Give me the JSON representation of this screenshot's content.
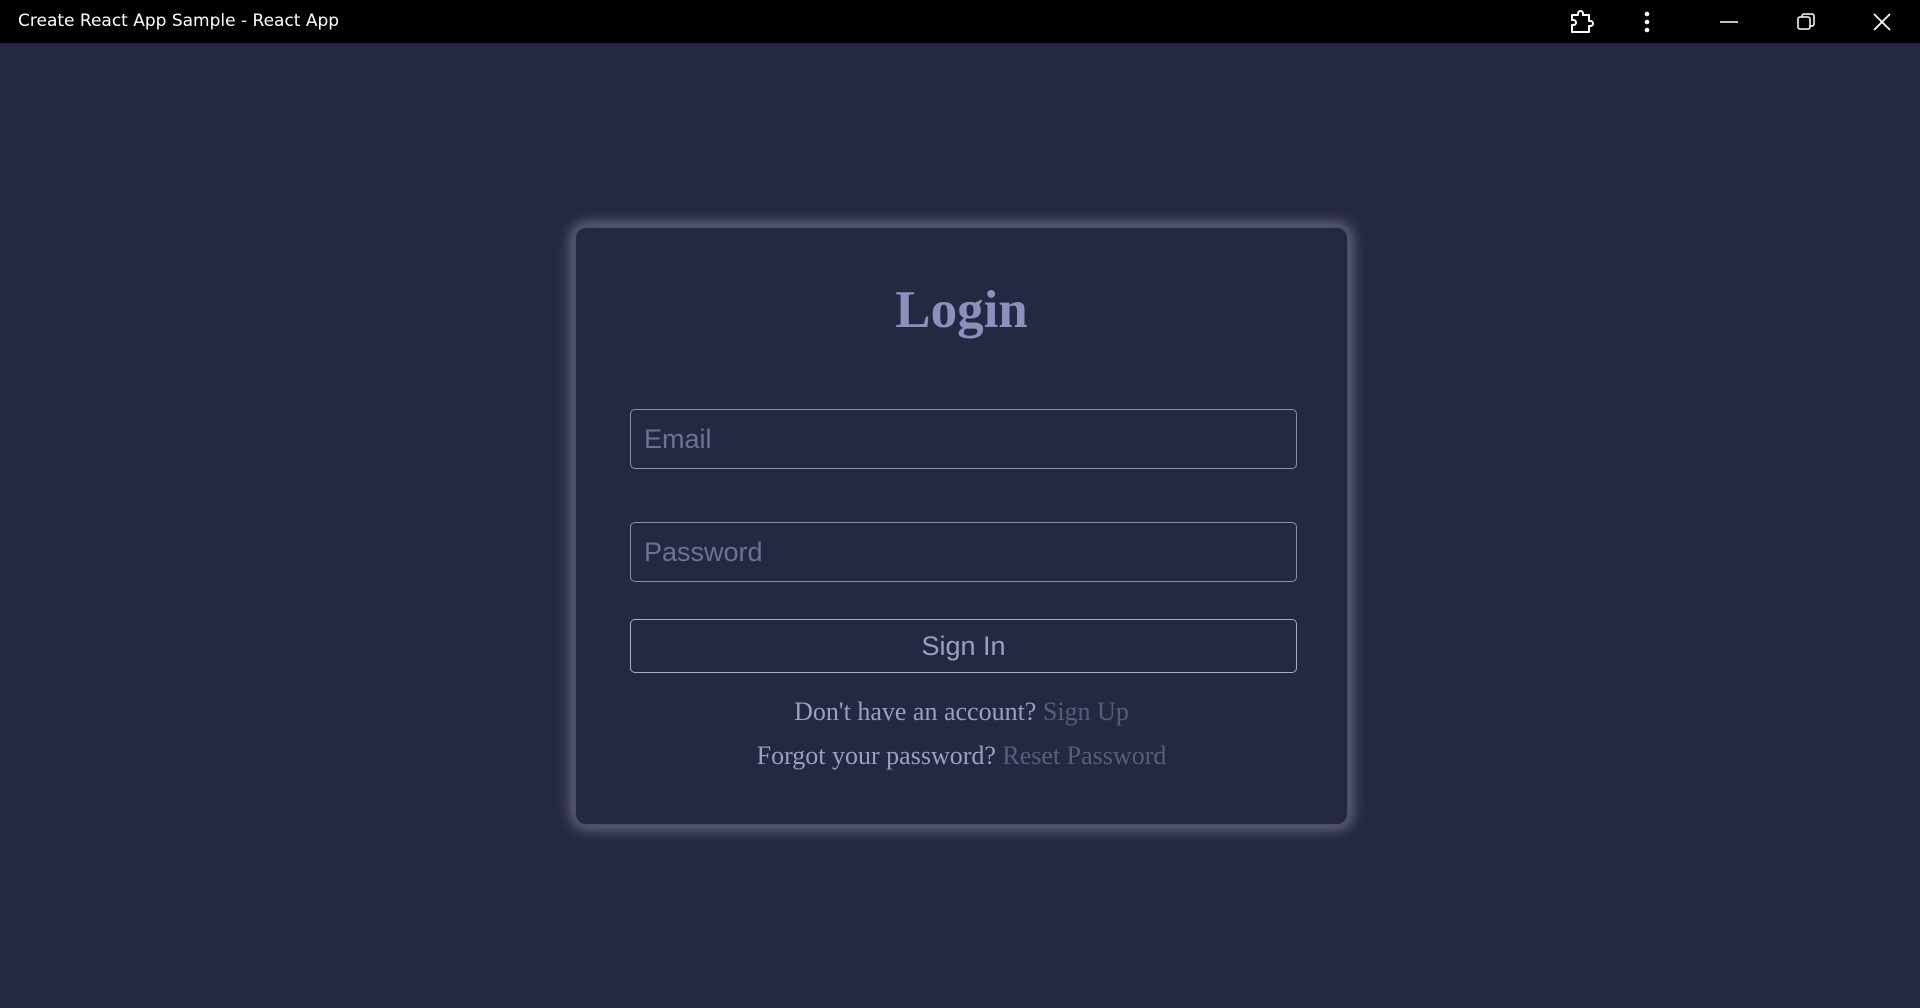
{
  "window": {
    "title": "Create React App Sample - React App"
  },
  "login": {
    "heading": "Login",
    "email_placeholder": "Email",
    "password_placeholder": "Password",
    "signin_label": "Sign In",
    "signup_prompt": "Don't have an account?",
    "signup_link": "Sign Up",
    "forgot_prompt": "Forgot your password?",
    "reset_link": "Reset Password"
  },
  "colors": {
    "background": "#242840",
    "titlebar": "#000000",
    "accent_text": "#8e8fbf",
    "link_text": "#5a5d7a"
  },
  "icons": {
    "extension": "puzzle-extension-icon",
    "more": "more-vertical-icon",
    "minimize": "minimize-icon",
    "restore": "restore-icon",
    "close": "close-icon"
  }
}
